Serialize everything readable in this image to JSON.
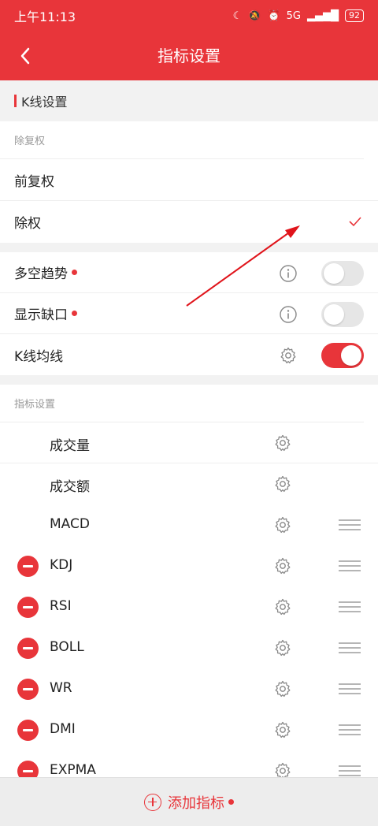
{
  "status": {
    "time": "上午11:13",
    "network": "5G",
    "battery": "92"
  },
  "header": {
    "title": "指标设置"
  },
  "kline_section": {
    "title": "K线设置"
  },
  "adjust": {
    "label": "除复权",
    "options": [
      {
        "label": "前复权",
        "selected": false
      },
      {
        "label": "除权",
        "selected": true
      }
    ]
  },
  "toggles": [
    {
      "label": "多空趋势",
      "dot": true,
      "icon": "info-icon",
      "on": false
    },
    {
      "label": "显示缺口",
      "dot": true,
      "icon": "info-icon",
      "on": false
    },
    {
      "label": "K线均线",
      "dot": false,
      "icon": "gear-icon",
      "on": true
    }
  ],
  "indicators": {
    "label": "指标设置",
    "items": [
      {
        "name": "成交量",
        "removable": false,
        "draggable": false
      },
      {
        "name": "成交额",
        "removable": false,
        "draggable": false
      },
      {
        "name": "MACD",
        "removable": false,
        "draggable": true
      },
      {
        "name": "KDJ",
        "removable": true,
        "draggable": true
      },
      {
        "name": "RSI",
        "removable": true,
        "draggable": true
      },
      {
        "name": "BOLL",
        "removable": true,
        "draggable": true
      },
      {
        "name": "WR",
        "removable": true,
        "draggable": true
      },
      {
        "name": "DMI",
        "removable": true,
        "draggable": true
      },
      {
        "name": "EXPMA",
        "removable": true,
        "draggable": true
      }
    ]
  },
  "footer": {
    "add_label": "添加指标"
  },
  "colors": {
    "accent": "#e8353a",
    "annotation": "#e0141b"
  }
}
